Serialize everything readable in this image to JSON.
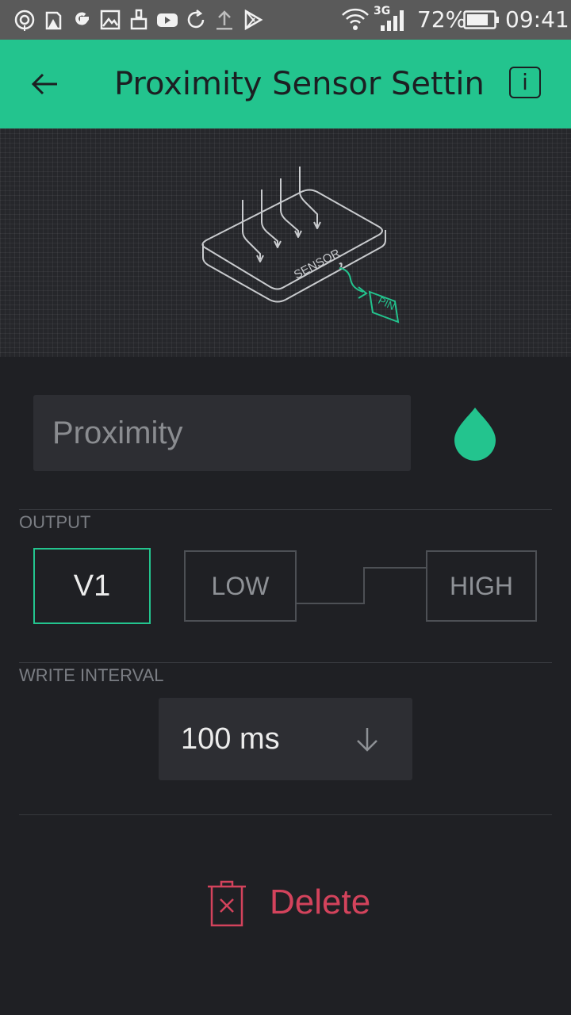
{
  "status_bar": {
    "battery_percent": "72%",
    "time": "09:41",
    "network_type": "3G",
    "icons": [
      "hotspot-icon",
      "warning-icon",
      "google-icon",
      "gallery-icon",
      "cleaner-icon",
      "youtube-icon",
      "sync-icon",
      "upload-icon",
      "play-store-icon",
      "wifi-icon",
      "signal-icon",
      "battery-icon"
    ]
  },
  "app_bar": {
    "title": "Proximity Sensor Settings",
    "back_icon": "arrow-left-icon",
    "info_label": "i"
  },
  "illustration": {
    "sensor_label": "SENSOR",
    "pin_label": "PIN",
    "accent_color": "#23c48e"
  },
  "widget": {
    "name_placeholder": "Proximity",
    "color": "#23c48e"
  },
  "output": {
    "label": "OUTPUT",
    "pin": "V1",
    "low_label": "LOW",
    "high_label": "HIGH"
  },
  "write_interval": {
    "label": "WRITE INTERVAL",
    "value": "100 ms"
  },
  "delete": {
    "label": "Delete",
    "color": "#d3435c"
  }
}
